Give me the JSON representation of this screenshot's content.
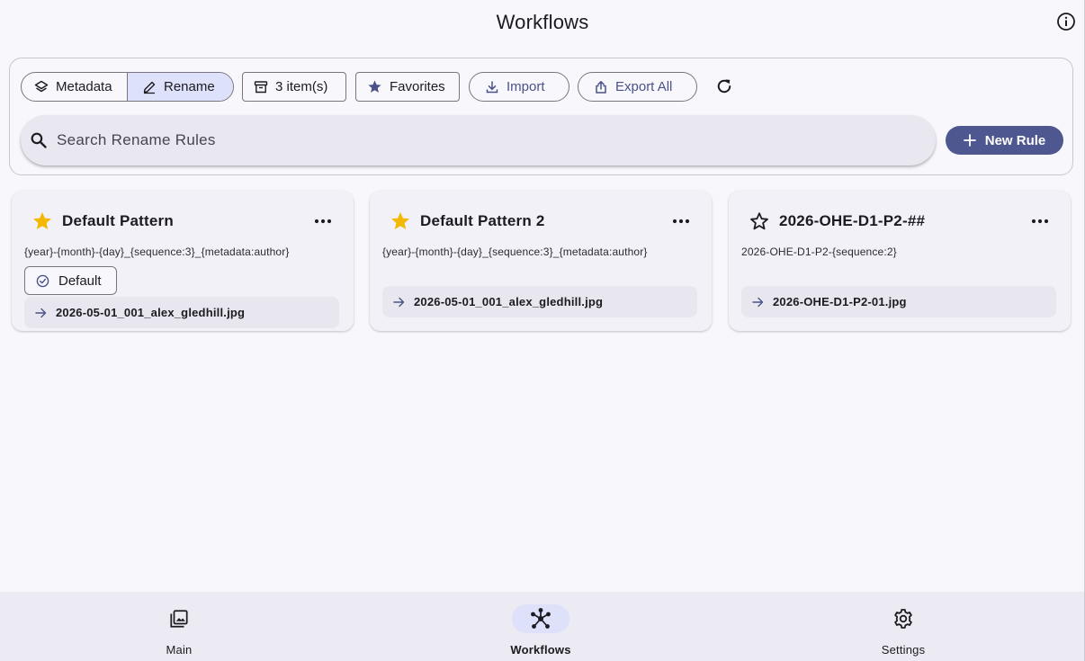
{
  "header": {
    "title": "Workflows",
    "info_icon": "info-icon"
  },
  "toolbar": {
    "segments": [
      {
        "label": "Metadata",
        "icon": "layers-icon",
        "active": false
      },
      {
        "label": "Rename",
        "icon": "pencil-icon",
        "active": true
      }
    ],
    "items_label": "3 item(s)",
    "favorites_label": "Favorites",
    "import_label": "Import",
    "export_label": "Export All",
    "refresh_icon": "refresh-icon"
  },
  "search": {
    "placeholder": "Search Rename Rules",
    "value": ""
  },
  "new_rule_label": "New Rule",
  "colors": {
    "accent": "#4e5790",
    "star": "#f5b800",
    "active_tint": "#dde1f9"
  },
  "cards": [
    {
      "title": "Default Pattern",
      "favorite": true,
      "pattern": "{year}-{month}-{day}_{sequence:3}_{metadata:author}",
      "default_chip": "Default",
      "preview": "2026-05-01_001_alex_gledhill.jpg"
    },
    {
      "title": "Default Pattern 2",
      "favorite": true,
      "pattern": "{year}-{month}-{day}_{sequence:3}_{metadata:author}",
      "preview": "2026-05-01_001_alex_gledhill.jpg"
    },
    {
      "title": "2026-OHE-D1-P2-##",
      "favorite": false,
      "pattern": "2026-OHE-D1-P2-{sequence:2}",
      "preview": "2026-OHE-D1-P2-01.jpg"
    }
  ],
  "nav": [
    {
      "label": "Main",
      "icon": "gallery-icon",
      "active": false
    },
    {
      "label": "Workflows",
      "icon": "workflow-icon",
      "active": true
    },
    {
      "label": "Settings",
      "icon": "gear-icon",
      "active": false
    }
  ]
}
